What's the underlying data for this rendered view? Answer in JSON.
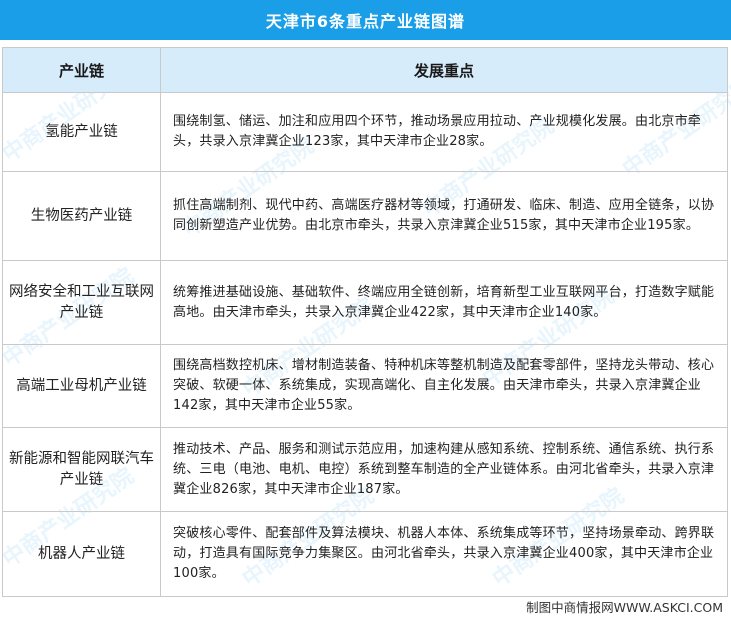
{
  "title": "天津市6条重点产业链图谱",
  "header": {
    "col1": "产业链",
    "col2": "发展重点"
  },
  "rows": [
    {
      "name": "氢能产业链",
      "desc": "围绕制氢、储运、加注和应用四个环节，推动场景应用拉动、产业规模化发展。由北京市牵头，共录入京津冀企业123家，其中天津市企业28家。"
    },
    {
      "name": "生物医药产业链",
      "desc": "抓住高端制剂、现代中药、高端医疗器材等领域，打通研发、临床、制造、应用全链条，以协同创新塑造产业优势。由北京市牵头，共录入京津冀企业515家，其中天津市企业195家。"
    },
    {
      "name": "网络安全和工业互联网产业链",
      "desc": "统筹推进基础设施、基础软件、终端应用全链创新，培育新型工业互联网平台，打造数字赋能高地。由天津市牵头，共录入京津冀企业422家，其中天津市企业140家。"
    },
    {
      "name": "高端工业母机产业链",
      "desc": "围绕高档数控机床、增材制造装备、特种机床等整机制造及配套零部件，坚持龙头带动、核心突破、软硬一体、系统集成，实现高端化、自主化发展。由天津市牵头，共录入京津冀企业142家，其中天津市企业55家。"
    },
    {
      "name": "新能源和智能网联汽车产业链",
      "desc": "推动技术、产品、服务和测试示范应用，加速构建从感知系统、控制系统、通信系统、执行系统、三电（电池、电机、电控）系统到整车制造的全产业链体系。由河北省牵头，共录入京津冀企业826家，其中天津市企业187家。"
    },
    {
      "name": "机器人产业链",
      "desc": "突破核心零件、配套部件及算法模块、机器人本体、系统集成等环节，坚持场景牵动、跨界联动，打造具有国际竞争力集聚区。由河北省牵头，共录入京津冀企业400家，其中天津市企业100家。"
    }
  ],
  "footer": "制图中商情报网WWW.ASKCI.COM",
  "watermark": "中商产业研究院",
  "colors": {
    "title_bg": "#1a9ee8",
    "header_bg": "#d7ecfa",
    "border": "#c9c9c9"
  }
}
